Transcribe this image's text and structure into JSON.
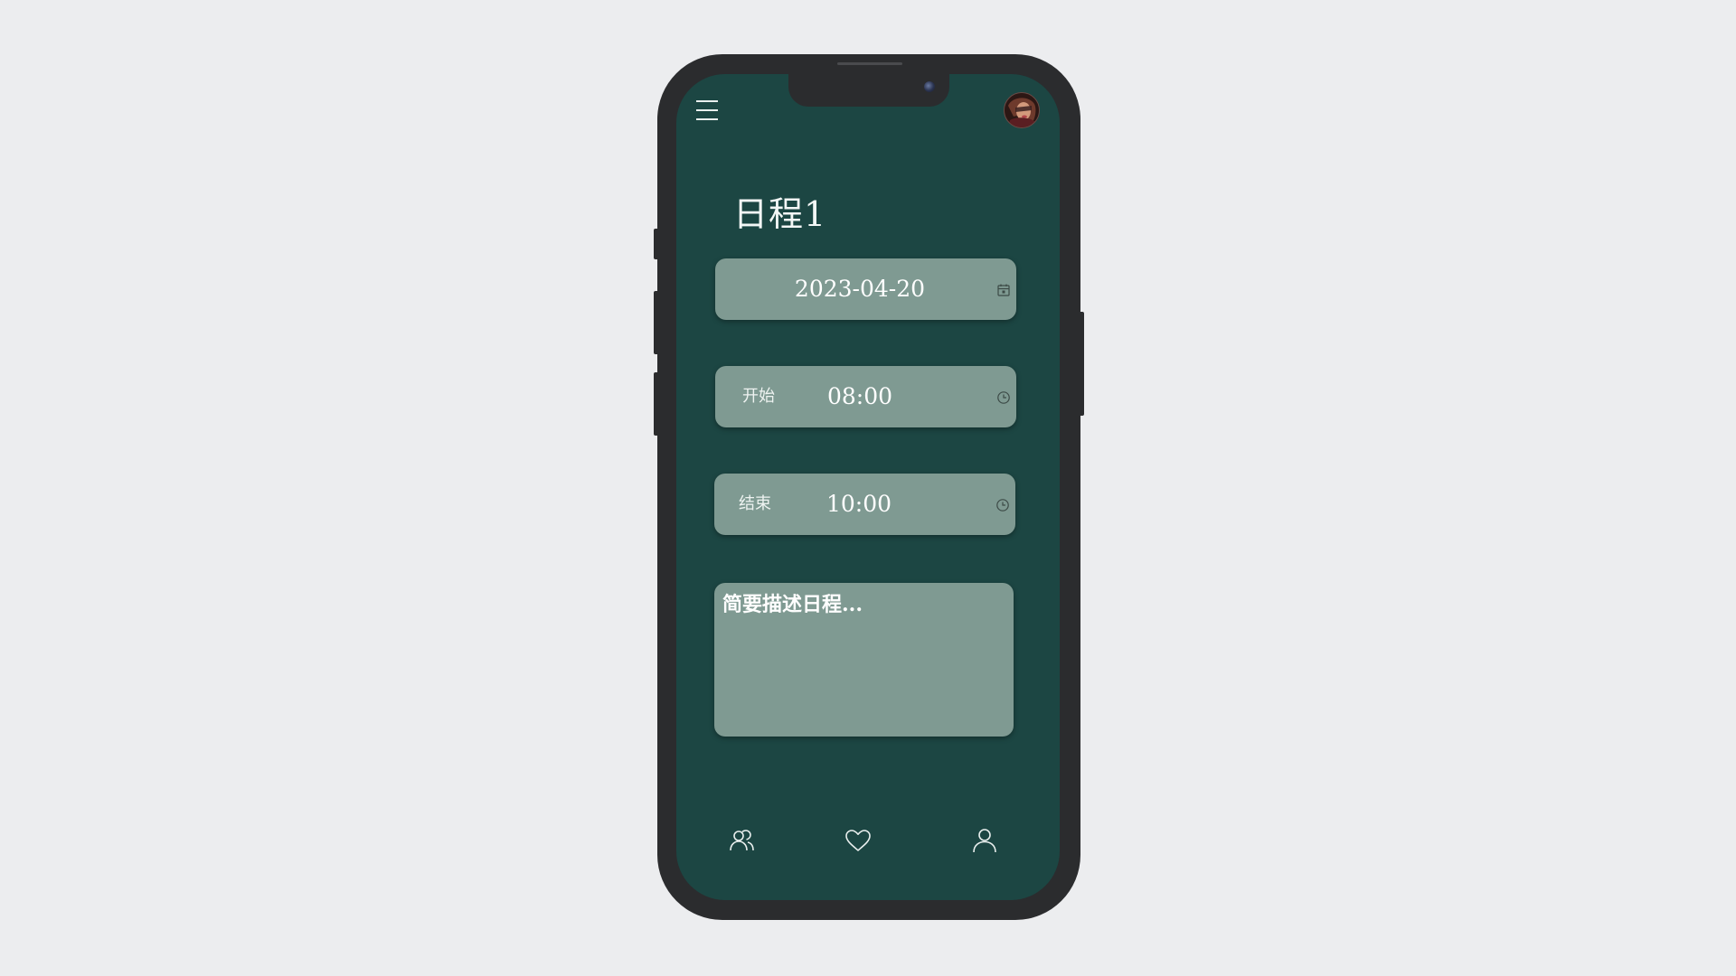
{
  "page": {
    "title": "日程1"
  },
  "date_field": {
    "value": "2023-04-20",
    "icon": "calendar-icon"
  },
  "start_field": {
    "label": "开始",
    "value": "08:00",
    "icon": "clock-icon"
  },
  "end_field": {
    "label": "结束",
    "value": "10:00",
    "icon": "clock-icon"
  },
  "description": {
    "placeholder": "简要描述日程..."
  },
  "bottom_nav": {
    "items": [
      {
        "icon": "friends-icon"
      },
      {
        "icon": "heart-icon"
      },
      {
        "icon": "user-icon"
      }
    ]
  },
  "colors": {
    "background": "#ecedef",
    "phone_frame": "#2b2c2e",
    "screen": "#1c4643",
    "field": "#7f9a92",
    "text": "#ffffff"
  }
}
